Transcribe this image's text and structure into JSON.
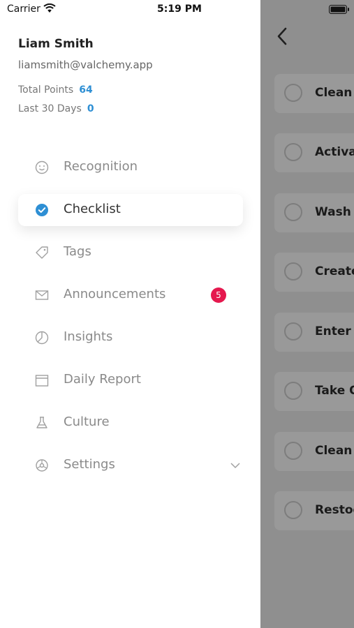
{
  "status_bar": {
    "carrier": "Carrier",
    "time": "5:19 PM"
  },
  "user": {
    "name": "Liam Smith",
    "email": "liamsmith@valchemy.app",
    "total_points_label": "Total Points",
    "total_points_value": "64",
    "last30_label": "Last 30 Days",
    "last30_value": "0"
  },
  "menu": {
    "items": [
      {
        "label": "Recognition",
        "icon": "smiley-icon"
      },
      {
        "label": "Checklist",
        "icon": "check-circle-icon",
        "active": true
      },
      {
        "label": "Tags",
        "icon": "tag-icon"
      },
      {
        "label": "Announcements",
        "icon": "mail-icon",
        "badge": "5"
      },
      {
        "label": "Insights",
        "icon": "pie-chart-icon"
      },
      {
        "label": "Daily Report",
        "icon": "calendar-icon"
      },
      {
        "label": "Culture",
        "icon": "flask-icon"
      },
      {
        "label": "Settings",
        "icon": "settings-icon"
      }
    ]
  },
  "background_screen": {
    "tasks": [
      "Clean F",
      "Activat",
      "Wash D",
      "Create",
      "Enter C",
      "Take O",
      "Clean V",
      "Restoc"
    ]
  },
  "colors": {
    "accent": "#2e8fd4",
    "badge": "#e5184e",
    "overlay": "#8f8f8f"
  }
}
